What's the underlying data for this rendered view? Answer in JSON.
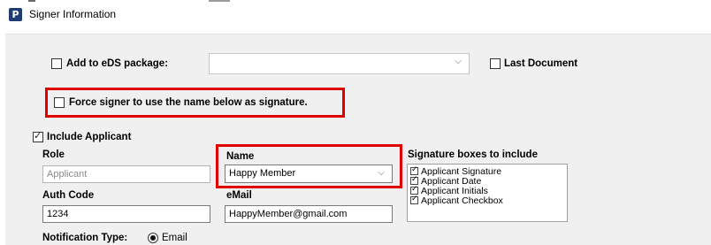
{
  "window": {
    "title": "Signer Information",
    "icon_letter": "P"
  },
  "eds": {
    "label": "Add to eDS package:",
    "checked": false,
    "value": ""
  },
  "last_document": {
    "label": "Last Document",
    "checked": false
  },
  "force_signer": {
    "label": "Force signer to use the name below as signature.",
    "checked": false
  },
  "include_applicant": {
    "label": "Include Applicant",
    "checked": true
  },
  "role": {
    "label": "Role",
    "value": "Applicant"
  },
  "name": {
    "label": "Name",
    "value": "Happy Member"
  },
  "auth_code": {
    "label": "Auth Code",
    "value": "1234"
  },
  "email": {
    "label": "eMail",
    "value": "HappyMember@gmail.com"
  },
  "signature_boxes": {
    "label": "Signature boxes to include",
    "items": [
      "Applicant Signature",
      "Applicant Date",
      "Applicant Initials",
      "Applicant Checkbox"
    ]
  },
  "notification": {
    "label": "Notification Type:",
    "option": "Email",
    "selected": true
  },
  "colors": {
    "highlight": "#e00000",
    "panel": "#f0f0f0",
    "icon": "#1f3b73"
  }
}
